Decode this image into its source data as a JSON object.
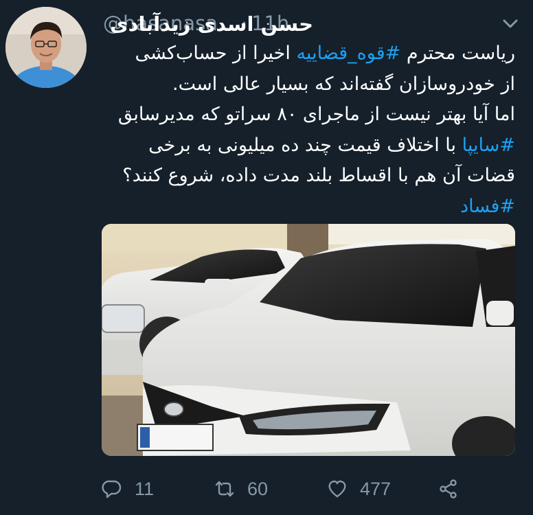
{
  "tweet": {
    "author_name": "حسن اسدی زیدآبادی",
    "author_handle": "@hasanasa...",
    "separator": "·",
    "time": "11h",
    "lines": [
      {
        "before": "ریاست محترم ",
        "tag": "#قوه_قضاییه",
        "after": " اخیرا از حساب‌کشی"
      },
      {
        "before": "از خودروسازان گفته‌اند که بسیار عالی است.",
        "tag": "",
        "after": ""
      },
      {
        "before": "اما آیا بهتر نیست از ماجرای ۸۰ سراتو که مدیرسابق",
        "tag": "",
        "after": ""
      },
      {
        "before": "",
        "tag": "#سایپا",
        "after": " با اختلاف قیمت چند ده میلیونی به برخی"
      },
      {
        "before": "قضات آن هم با اقساط بلند مدت داده، شروع کنند؟",
        "tag": "",
        "after": ""
      },
      {
        "before": "",
        "tag": "#فساد",
        "after": ""
      }
    ]
  },
  "actions": {
    "reply_count": "11",
    "retweet_count": "60",
    "like_count": "477"
  },
  "colors": {
    "background": "#15202b",
    "text": "#ffffff",
    "muted": "#8899a6",
    "hashtag": "#1da1f2"
  },
  "icons": [
    "chevron-down-icon",
    "reply-icon",
    "retweet-icon",
    "like-icon",
    "share-icon"
  ]
}
